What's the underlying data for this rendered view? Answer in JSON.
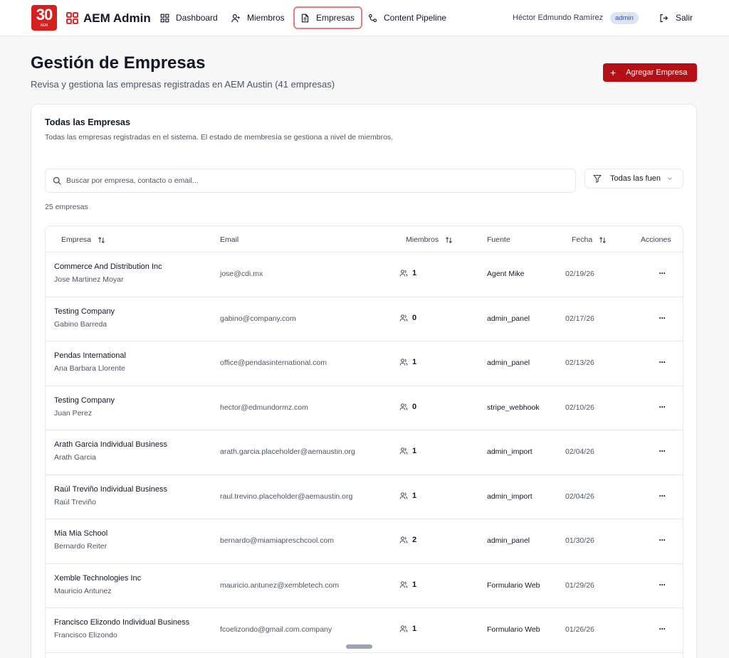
{
  "nav": {
    "logo_number": "30",
    "logo_sub": "AEM",
    "brand": "AEM Admin",
    "items": [
      {
        "label": "Dashboard",
        "icon": "dashboard-grid-icon"
      },
      {
        "label": "Miembros",
        "icon": "user-plus-icon"
      },
      {
        "label": "Empresas",
        "icon": "document-icon"
      },
      {
        "label": "Content Pipeline",
        "icon": "pipeline-icon"
      }
    ],
    "user_name": "Héctor Edmundo Ramírez",
    "role_badge": "admin",
    "logout_label": "Salir"
  },
  "header": {
    "title": "Gestión de Empresas",
    "subtitle": "Revisa y gestiona las empresas registradas en AEM Austin (41 empresas)",
    "add_button": "Agregar Empresa"
  },
  "card": {
    "title": "Todas las Empresas",
    "subtitle": "Todas las empresas registradas en el sistema. El estado de membresía se gestiona a nivel de miembros.",
    "search_placeholder": "Buscar por empresa, contacto o email...",
    "filter_value": "Todas las fuen",
    "count": "25 empresas"
  },
  "table": {
    "headers": {
      "company": "Empresa",
      "email": "Email",
      "members": "Miembros",
      "source": "Fuente",
      "date": "Fecha",
      "actions": "Acciones"
    },
    "rows": [
      {
        "company": "Commerce And Distribution Inc",
        "contact": "Jose Martinez Moyar",
        "email": "jose@cdi.mx",
        "members": "1",
        "source": "Agent Mike",
        "date": "02/19/26",
        "actions": "···"
      },
      {
        "company": "Testing Company",
        "contact": "Gabino Barreda",
        "email": "gabino@company.com",
        "members": "0",
        "source": "admin_panel",
        "date": "02/17/26",
        "actions": "···"
      },
      {
        "company": "Pendas International",
        "contact": "Ana Barbara Llorente",
        "email": "office@pendasinternational.com",
        "members": "1",
        "source": "admin_panel",
        "date": "02/13/26",
        "actions": "···"
      },
      {
        "company": "Testing Company",
        "contact": "Juan Perez",
        "email": "hector@edmundormz.com",
        "members": "0",
        "source": "stripe_webhook",
        "date": "02/10/26",
        "actions": "···"
      },
      {
        "company": "Arath Garcia Individual Business",
        "contact": "Arath Garcia",
        "email": "arath.garcia.placeholder@aemaustin.org",
        "members": "1",
        "source": "admin_import",
        "date": "02/04/26",
        "actions": "···"
      },
      {
        "company": "Raúl Treviño Individual Business",
        "contact": "Raúl Treviño",
        "email": "raul.trevino.placeholder@aemaustin.org",
        "members": "1",
        "source": "admin_import",
        "date": "02/04/26",
        "actions": "···"
      },
      {
        "company": "Mia Mia School",
        "contact": "Bernardo Reiter",
        "email": "bernardo@miamiapreschcool.com",
        "members": "2",
        "source": "admin_panel",
        "date": "01/30/26",
        "actions": "···"
      },
      {
        "company": "Xemble Technologies Inc",
        "contact": "Mauricio Antunez",
        "email": "mauricio.antunez@xembletech.com",
        "members": "1",
        "source": "Formulario Web",
        "date": "01/29/26",
        "actions": "···"
      },
      {
        "company": "Francisco Elizondo Individual Business",
        "contact": "Francisco Elizondo",
        "email": "fcoelizondo@gmail.com.company",
        "members": "1",
        "source": "Formulario Web",
        "date": "01/26/26",
        "actions": "···"
      }
    ]
  },
  "colors": {
    "brand_red": "#d62020",
    "button_red": "#b31116",
    "active_border": "#e37d80",
    "badge_bg": "#dbe4f5"
  }
}
